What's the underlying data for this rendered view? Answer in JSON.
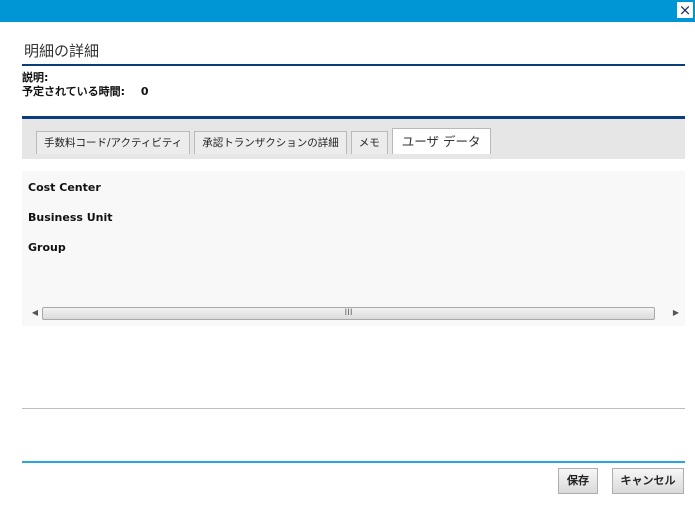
{
  "window": {
    "close_glyph": "×"
  },
  "dialog": {
    "title": "明細の詳細",
    "description_label": "説明:",
    "description_value": "",
    "planned_time_label": "予定されている時間:",
    "planned_time_value": "0"
  },
  "tabs": [
    {
      "label": "手数料コード/アクティビティ",
      "active": false
    },
    {
      "label": "承認トランザクションの詳細",
      "active": false
    },
    {
      "label": "メモ",
      "active": false
    },
    {
      "label": "ユーザ データ",
      "active": true
    }
  ],
  "user_data_fields": [
    {
      "label": "Cost Center"
    },
    {
      "label": "Business Unit"
    },
    {
      "label": "Group"
    }
  ],
  "scrollbar": {
    "left_arrow": "◀",
    "right_arrow": "▶",
    "grip": "III"
  },
  "footer": {
    "save_label": "保存",
    "cancel_label": "キャンセル"
  },
  "colors": {
    "titlebar": "#0096d6",
    "rule_dark": "#0b3d7a",
    "rule_light": "#2aa6dd"
  }
}
